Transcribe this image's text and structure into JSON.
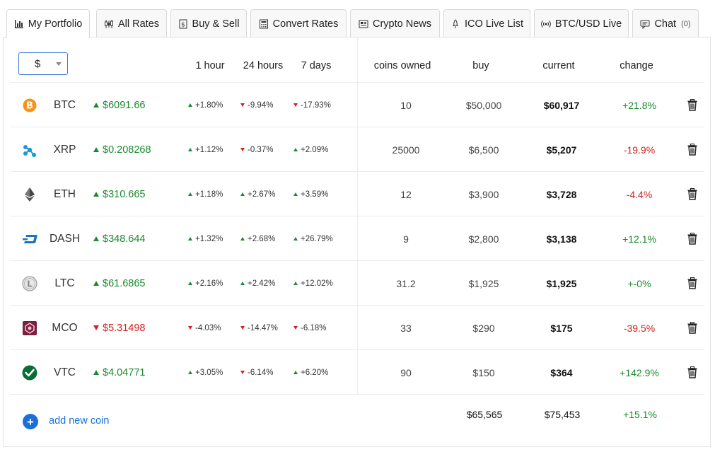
{
  "tabs": [
    {
      "label": "My Portfolio",
      "icon": "bar-chart-icon"
    },
    {
      "label": "All Rates",
      "icon": "candlestick-icon"
    },
    {
      "label": "Buy & Sell",
      "icon": "dollar-doc-icon"
    },
    {
      "label": "Convert Rates",
      "icon": "calculator-icon"
    },
    {
      "label": "Crypto News",
      "icon": "newspaper-icon"
    },
    {
      "label": "ICO Live List",
      "icon": "rocket-icon"
    },
    {
      "label": "BTC/USD Live",
      "icon": "broadcast-icon"
    },
    {
      "label": "Chat",
      "icon": "chat-icon",
      "count": "(0)"
    }
  ],
  "currency_select": {
    "value": "$"
  },
  "headers": {
    "h1": "1 hour",
    "h24": "24 hours",
    "d7": "7 days",
    "owned": "coins owned",
    "buy": "buy",
    "current": "current",
    "change": "change"
  },
  "coins": [
    {
      "symbol": "BTC",
      "price": "$6091.66",
      "price_dir": "up",
      "h1": "+1.80%",
      "h1_dir": "up",
      "h24": "-9.94%",
      "h24_dir": "down",
      "d7": "-17.93%",
      "d7_dir": "down",
      "owned": "10",
      "buy": "$50,000",
      "current": "$60,917",
      "change": "+21.8%",
      "change_dir": "up"
    },
    {
      "symbol": "XRP",
      "price": "$0.208268",
      "price_dir": "up",
      "h1": "+1.12%",
      "h1_dir": "up",
      "h24": "-0.37%",
      "h24_dir": "down",
      "d7": "+2.09%",
      "d7_dir": "up",
      "owned": "25000",
      "buy": "$6,500",
      "current": "$5,207",
      "change": "-19.9%",
      "change_dir": "down"
    },
    {
      "symbol": "ETH",
      "price": "$310.665",
      "price_dir": "up",
      "h1": "+1.18%",
      "h1_dir": "up",
      "h24": "+2.67%",
      "h24_dir": "up",
      "d7": "+3.59%",
      "d7_dir": "up",
      "owned": "12",
      "buy": "$3,900",
      "current": "$3,728",
      "change": "-4.4%",
      "change_dir": "down"
    },
    {
      "symbol": "DASH",
      "price": "$348.644",
      "price_dir": "up",
      "h1": "+1.32%",
      "h1_dir": "up",
      "h24": "+2.68%",
      "h24_dir": "up",
      "d7": "+26.79%",
      "d7_dir": "up",
      "owned": "9",
      "buy": "$2,800",
      "current": "$3,138",
      "change": "+12.1%",
      "change_dir": "up"
    },
    {
      "symbol": "LTC",
      "price": "$61.6865",
      "price_dir": "up",
      "h1": "+2.16%",
      "h1_dir": "up",
      "h24": "+2.42%",
      "h24_dir": "up",
      "d7": "+12.02%",
      "d7_dir": "up",
      "owned": "31.2",
      "buy": "$1,925",
      "current": "$1,925",
      "change": "+-0%",
      "change_dir": "up"
    },
    {
      "symbol": "MCO",
      "price": "$5.31498",
      "price_dir": "down",
      "h1": "-4.03%",
      "h1_dir": "down",
      "h24": "-14.47%",
      "h24_dir": "down",
      "d7": "-6.18%",
      "d7_dir": "down",
      "owned": "33",
      "buy": "$290",
      "current": "$175",
      "change": "-39.5%",
      "change_dir": "down"
    },
    {
      "symbol": "VTC",
      "price": "$4.04771",
      "price_dir": "up",
      "h1": "+3.05%",
      "h1_dir": "up",
      "h24": "-6.14%",
      "h24_dir": "down",
      "d7": "+6.20%",
      "d7_dir": "up",
      "owned": "90",
      "buy": "$150",
      "current": "$364",
      "change": "+142.9%",
      "change_dir": "up"
    }
  ],
  "footer": {
    "add_label": "add new coin",
    "total_buy": "$65,565",
    "total_current": "$75,453",
    "total_change": "+15.1%"
  },
  "colors": {
    "up": "#1b8a2e",
    "down": "#d42020",
    "accent": "#1a6fd8"
  }
}
